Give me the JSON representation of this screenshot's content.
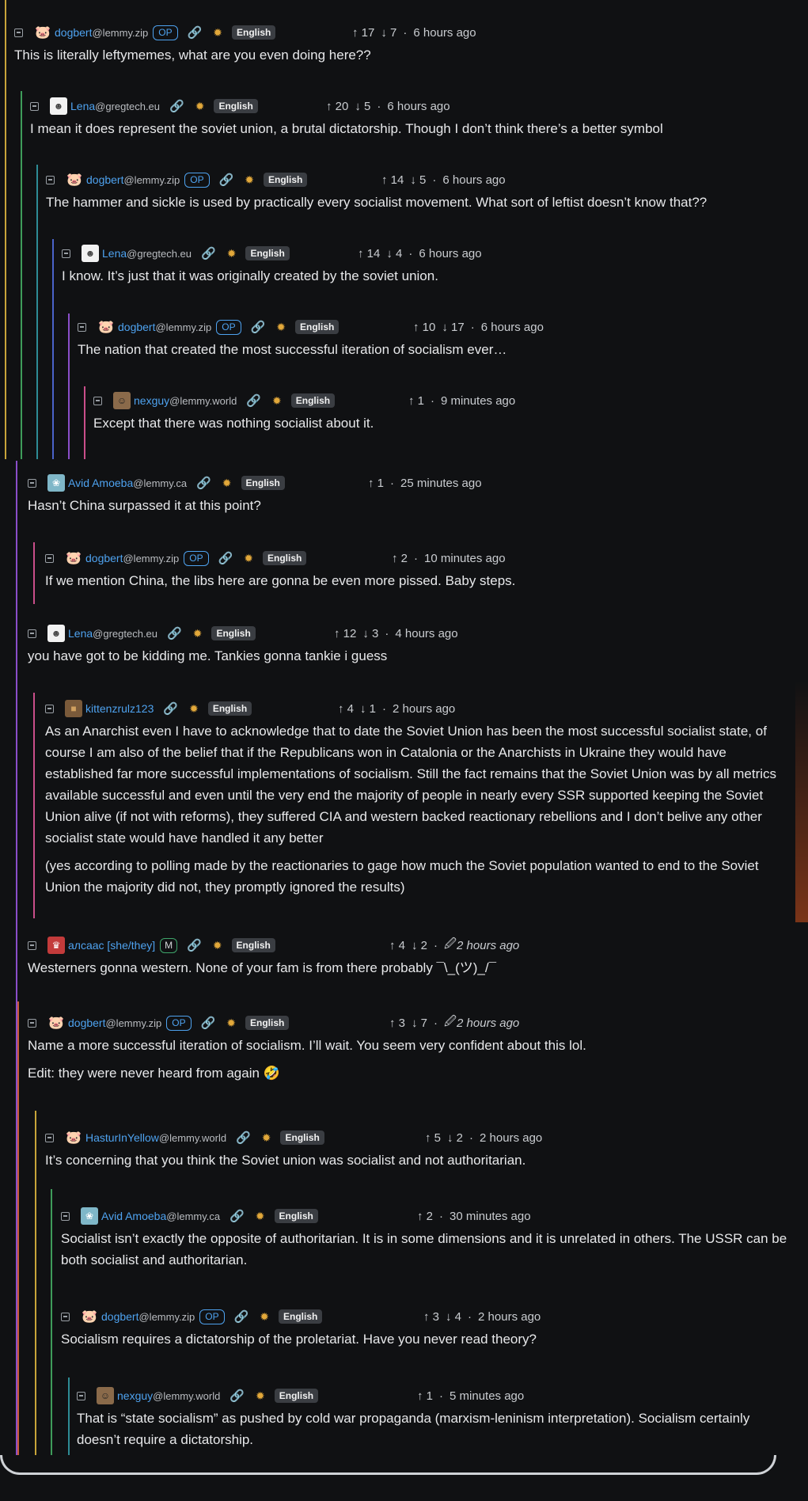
{
  "labels": {
    "lang": "English",
    "op": "OP",
    "mod": "M",
    "dot": "·"
  },
  "colors": {
    "background": "#101113",
    "username": "#4ea2ef",
    "op_badge": "#4ea2ef",
    "mod_badge": "#3ea56a",
    "language_badge": "#3a3d42",
    "thread_lines": [
      "#c7a43a",
      "#3e9c5a",
      "#2e8c95",
      "#4a63c9",
      "#8a4ec9",
      "#c94e8a",
      "#c95a3a"
    ]
  },
  "comments": [
    {
      "user": "dogbert",
      "instance": "@lemmy.zip",
      "avatar": "dog-icon",
      "op": true,
      "up": "↑ 17",
      "down": "↓ 7",
      "time": "6 hours ago",
      "body": [
        "This is literally leftymemes, what are you even doing here??"
      ]
    },
    {
      "user": "Lena",
      "instance": "@gregtech.eu",
      "avatar": "lena-icon",
      "up": "↑ 20",
      "down": "↓ 5",
      "time": "6 hours ago",
      "body": [
        "I mean it does represent the soviet union, a brutal dictatorship. Though I don’t think there’s a better symbol"
      ]
    },
    {
      "user": "dogbert",
      "instance": "@lemmy.zip",
      "avatar": "dog-icon",
      "op": true,
      "up": "↑ 14",
      "down": "↓ 5",
      "time": "6 hours ago",
      "body": [
        "The hammer and sickle is used by practically every socialist movement. What sort of leftist doesn’t know that??"
      ]
    },
    {
      "user": "Lena",
      "instance": "@gregtech.eu",
      "avatar": "lena-icon",
      "up": "↑ 14",
      "down": "↓ 4",
      "time": "6 hours ago",
      "body": [
        "I know. It’s just that it was originally created by the soviet union."
      ]
    },
    {
      "user": "dogbert",
      "instance": "@lemmy.zip",
      "avatar": "dog-icon",
      "op": true,
      "up": "↑ 10",
      "down": "↓ 17",
      "time": "6 hours ago",
      "body": [
        "The nation that created the most successful iteration of socialism ever…"
      ]
    },
    {
      "user": "nexguy",
      "instance": "@lemmy.world",
      "avatar": "nexguy-icon",
      "up": "↑ 1",
      "down": "",
      "time": "9 minutes ago",
      "body": [
        "Except that there was nothing socialist about it."
      ]
    },
    {
      "user": "Avid Amoeba",
      "instance": "@lemmy.ca",
      "avatar": "amoeba-icon",
      "up": "↑ 1",
      "down": "",
      "time": "25 minutes ago",
      "body": [
        "Hasn’t China surpassed it at this point?"
      ]
    },
    {
      "user": "dogbert",
      "instance": "@lemmy.zip",
      "avatar": "dog-icon",
      "op": true,
      "up": "↑ 2",
      "down": "",
      "time": "10 minutes ago",
      "body": [
        "If we mention China, the libs here are gonna be even more pissed. Baby steps."
      ]
    },
    {
      "user": "Lena",
      "instance": "@gregtech.eu",
      "avatar": "lena-icon",
      "up": "↑ 12",
      "down": "↓ 3",
      "time": "4 hours ago",
      "body": [
        "you have got to be kidding me. Tankies gonna tankie i guess"
      ]
    },
    {
      "user": "kittenzrulz123",
      "instance": "",
      "avatar": "kitten-icon",
      "up": "↑ 4",
      "down": "↓ 1",
      "time": "2 hours ago",
      "body": [
        "As an Anarchist even I have to acknowledge that to date the Soviet Union has been the most successful socialist state, of course I am also of the belief that if the Republicans won in Catalonia or the Anarchists in Ukraine they would have established far more successful implementations of socialism. Still the fact remains that the Soviet Union was by all metrics available successful and even until the very end the majority of people in nearly every SSR supported keeping the Soviet Union alive (if not with reforms), they suffered CIA and western backed reactionary rebellions and I don’t belive any other socialist state would have handled it any better",
        "(yes according to polling made by the reactionaries to gage how much the Soviet population wanted to end to the Soviet Union the majority did not, they promptly ignored the results)"
      ]
    },
    {
      "user": "алсаас [she/they]",
      "instance": "",
      "avatar": "alsaas-icon",
      "mod": true,
      "up": "↑ 4",
      "down": "↓ 2",
      "time": "2 hours ago",
      "edited": true,
      "body": [
        "Westerners gonna western. None of your fam is from there probably ¯\\_(ツ)_/¯"
      ]
    },
    {
      "user": "dogbert",
      "instance": "@lemmy.zip",
      "avatar": "dog-icon",
      "op": true,
      "up": "↑ 3",
      "down": "↓ 7",
      "time": "2 hours ago",
      "edited": true,
      "body": [
        "Name a more successful iteration of socialism. I’ll wait. You seem very confident about this lol.",
        "Edit: they were never heard from again 🤣"
      ]
    },
    {
      "user": "HasturInYellow",
      "instance": "@lemmy.world",
      "avatar": "hastur-icon",
      "up": "↑ 5",
      "down": "↓ 2",
      "time": "2 hours ago",
      "body": [
        "It’s concerning that you think the Soviet union was socialist and not authoritarian."
      ]
    },
    {
      "user": "Avid Amoeba",
      "instance": "@lemmy.ca",
      "avatar": "amoeba-icon",
      "up": "↑ 2",
      "down": "",
      "time": "30 minutes ago",
      "body": [
        "Socialist isn’t exactly the opposite of authoritarian. It is in some dimensions and it is unrelated in others. The USSR can be both socialist and authoritarian."
      ]
    },
    {
      "user": "dogbert",
      "instance": "@lemmy.zip",
      "avatar": "dog-icon",
      "op": true,
      "up": "↑ 3",
      "down": "↓ 4",
      "time": "2 hours ago",
      "body": [
        "Socialism requires a dictatorship of the proletariat. Have you never read theory?"
      ]
    },
    {
      "user": "nexguy",
      "instance": "@lemmy.world",
      "avatar": "nexguy-icon",
      "up": "↑ 1",
      "down": "",
      "time": "5 minutes ago",
      "body": [
        "That is “state socialism” as pushed by cold war propaganda (marxism-leninism interpretation). Socialism certainly doesn’t require a dictatorship."
      ]
    }
  ]
}
